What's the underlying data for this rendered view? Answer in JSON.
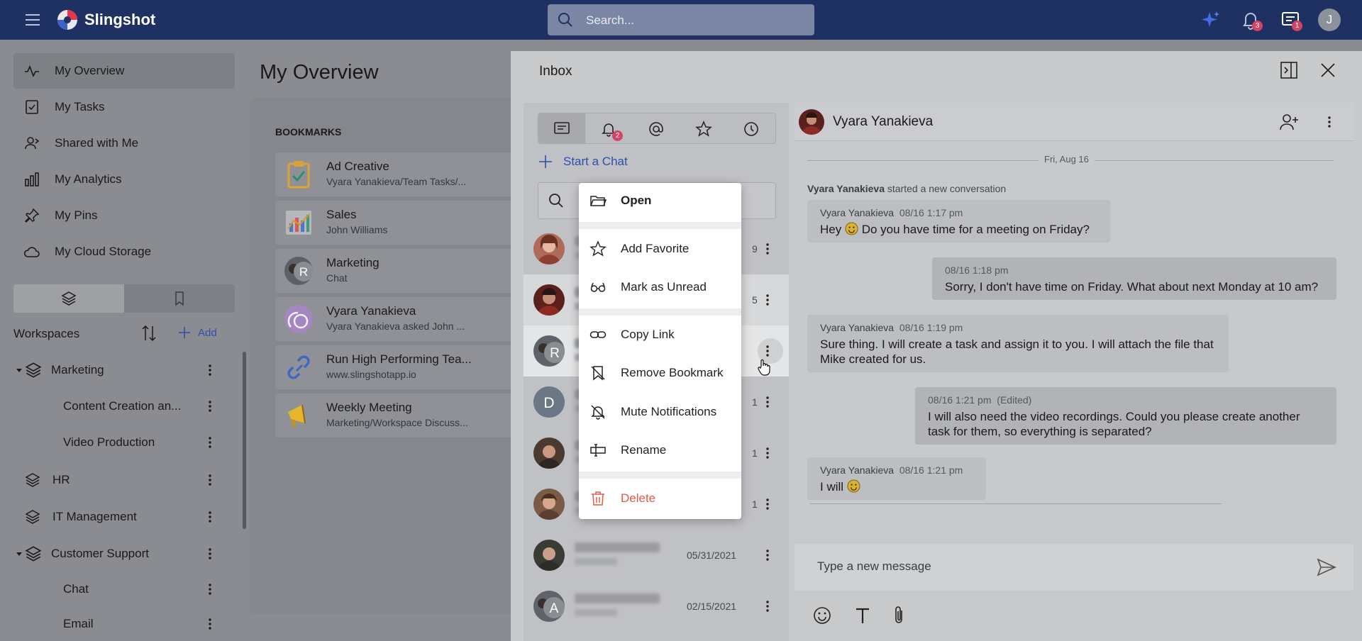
{
  "topbar": {
    "brand": "Slingshot",
    "search_placeholder": "Search...",
    "notifications_badge": "3",
    "messages_badge": "1",
    "avatar_initial": "J"
  },
  "sidebar": {
    "nav": [
      {
        "label": "My Overview",
        "icon": "pulse-icon"
      },
      {
        "label": "My Tasks",
        "icon": "task-icon"
      },
      {
        "label": "Shared with Me",
        "icon": "shared-user-icon"
      },
      {
        "label": "My Analytics",
        "icon": "analytics-icon"
      },
      {
        "label": "My Pins",
        "icon": "pin-icon"
      },
      {
        "label": "My Cloud Storage",
        "icon": "cloud-icon"
      }
    ],
    "workspaces_label": "Workspaces",
    "add_label": "Add",
    "workspaces": [
      {
        "label": "Marketing"
      },
      {
        "label": "Content Creation an..."
      },
      {
        "label": "Video Production"
      },
      {
        "label": "HR"
      },
      {
        "label": "IT Management"
      },
      {
        "label": "Customer Support"
      },
      {
        "label": "Chat"
      },
      {
        "label": "Email"
      }
    ]
  },
  "overview": {
    "title": "My Overview",
    "bookmarks_label": "BOOKMARKS",
    "bookmarks": [
      {
        "title": "Ad Creative",
        "subtitle": "Vyara Yanakieva/Team Tasks/..."
      },
      {
        "title": "Sales",
        "subtitle": "John Williams"
      },
      {
        "title": "Marketing",
        "subtitle": "Chat"
      },
      {
        "title": "Vyara Yanakieva",
        "subtitle": "Vyara Yanakieva asked John ..."
      },
      {
        "title": "Run High Performing Tea...",
        "subtitle": "www.slingshotapp.io"
      },
      {
        "title": "Weekly Meeting",
        "subtitle": "Marketing/Workspace Discuss..."
      }
    ]
  },
  "inbox": {
    "title": "Inbox",
    "notif_tab_badge": "2",
    "start_chat_label": "Start a Chat",
    "chats": [
      {
        "date": "9"
      },
      {
        "date": "5"
      },
      {
        "date": ""
      },
      {
        "date": "1"
      },
      {
        "date": "1"
      },
      {
        "date": "1"
      },
      {
        "date": "05/31/2021"
      },
      {
        "date": "02/15/2021"
      }
    ],
    "chat_initials": {
      "r": "R",
      "d": "D",
      "a": "A"
    }
  },
  "context_menu": {
    "items": [
      {
        "label": "Open",
        "icon": "folder-open-icon"
      },
      {
        "label": "Add Favorite",
        "icon": "star-icon"
      },
      {
        "label": "Mark as Unread",
        "icon": "glasses-icon"
      },
      {
        "label": "Copy Link",
        "icon": "link-icon"
      },
      {
        "label": "Remove Bookmark",
        "icon": "remove-bookmark-icon"
      },
      {
        "label": "Mute Notifications",
        "icon": "bell-off-icon"
      },
      {
        "label": "Rename",
        "icon": "rename-icon"
      },
      {
        "label": "Delete",
        "icon": "trash-icon"
      }
    ],
    "delete_color": "#e05a4a"
  },
  "conversation": {
    "name": "Vyara Yanakieva",
    "date_separator": "Fri, Aug 16",
    "system_author": "Vyara Yanakieva",
    "system_action": "started a new conversation",
    "messages": [
      {
        "author": "Vyara Yanakieva",
        "time": "08/16 1:17 pm",
        "text_before": "Hey ",
        "text_after": " Do you have time for a meeting on Friday?"
      },
      {
        "author": "",
        "time": "08/16 1:18 pm",
        "text": "Sorry, I don't have time on Friday. What about next Monday at 10 am?"
      },
      {
        "author": "Vyara Yanakieva",
        "time": "08/16 1:19 pm",
        "text": "Sure thing. I will create a task and assign it to you. I will attach the file that Mike created for us."
      },
      {
        "author": "",
        "time": "08/16 1:21 pm",
        "edited": "(Edited)",
        "text": "I will also need the video recordings. Could you please create another task for them, so everything is separated?"
      },
      {
        "author": "Vyara Yanakieva",
        "time": "08/16 1:21 pm",
        "text_before": "I will "
      }
    ],
    "composer_placeholder": "Type a new message"
  },
  "colors": {
    "topbar": "#1f3163",
    "accent": "#2c4fae",
    "badge": "#d34363"
  }
}
